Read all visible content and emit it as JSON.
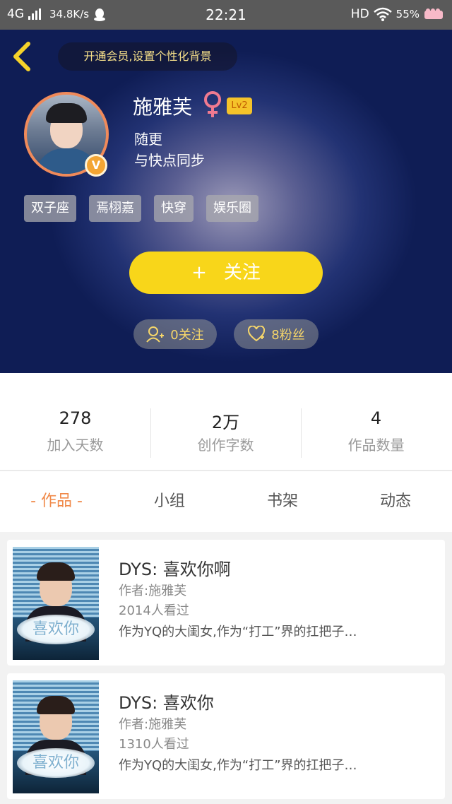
{
  "status_bar": {
    "network": "4G",
    "speed": "34.8K/s",
    "time": "22:21",
    "hd": "HD",
    "battery": "55%"
  },
  "header": {
    "vip_prompt": "开通会员,设置个性化背景"
  },
  "profile": {
    "name": "施雅芙",
    "level": "Lv2",
    "verified_badge": "V",
    "bio_line1": "随更",
    "bio_line2": "与快点同步",
    "tags": [
      "双子座",
      "焉栩嘉",
      "快穿",
      "娱乐圈"
    ],
    "follow_button_plus": "+",
    "follow_button_label": "关注",
    "following_label": "0关注",
    "fans_label": "8粉丝"
  },
  "stats": [
    {
      "value": "278",
      "label": "加入天数"
    },
    {
      "value": "2万",
      "label": "创作字数"
    },
    {
      "value": "4",
      "label": "作品数量"
    }
  ],
  "tabs": [
    {
      "label": "- 作品 -",
      "active": true
    },
    {
      "label": "小组",
      "active": false
    },
    {
      "label": "书架",
      "active": false
    },
    {
      "label": "动态",
      "active": false
    }
  ],
  "works": [
    {
      "title": "DYS: 喜欢你啊",
      "author": "作者:施雅芙",
      "views": "2014人看过",
      "desc": "作为YQ的大闺女,作为“打工”界的扛把子…",
      "cover_text": "喜欢你"
    },
    {
      "title": "DYS: 喜欢你",
      "author": "作者:施雅芙",
      "views": "1310人看过",
      "desc": "作为YQ的大闺女,作为“打工”界的扛把子…",
      "cover_text": "喜欢你"
    }
  ],
  "colors": {
    "accent_yellow": "#f8d61a",
    "tab_active": "#f08a4a",
    "avatar_ring": "#f08a5a",
    "gender": "#f07a90"
  }
}
